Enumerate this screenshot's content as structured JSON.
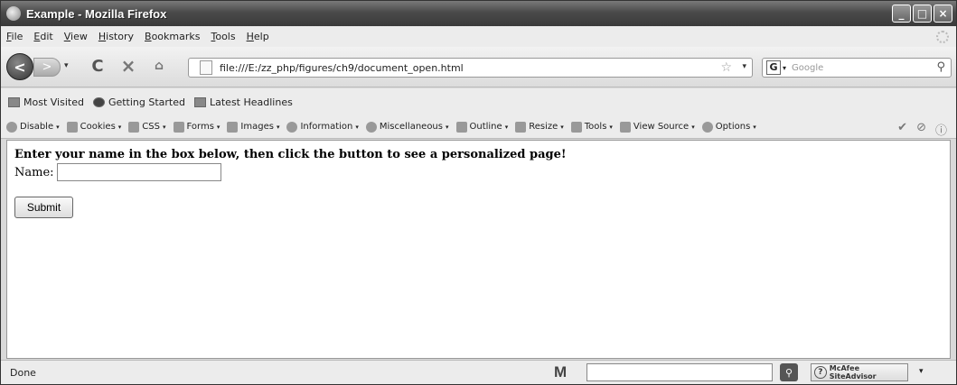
{
  "window": {
    "title": "Example - Mozilla Firefox"
  },
  "menu": [
    "File",
    "Edit",
    "View",
    "History",
    "Bookmarks",
    "Tools",
    "Help"
  ],
  "nav": {
    "url": "file:///E:/zz_php/figures/ch9/document_open.html",
    "search_placeholder": "Google"
  },
  "bookmarks": [
    "Most Visited",
    "Getting Started",
    "Latest Headlines"
  ],
  "devtoolbar": [
    "Disable",
    "Cookies",
    "CSS",
    "Forms",
    "Images",
    "Information",
    "Miscellaneous",
    "Outline",
    "Resize",
    "Tools",
    "View Source",
    "Options"
  ],
  "content": {
    "heading": "Enter your name in the box below, then click the button to see a personalized page!",
    "name_label": "Name:",
    "name_value": "",
    "submit_label": "Submit"
  },
  "status": {
    "text": "Done",
    "m_logo": "M",
    "siteadvisor": "McAfee SiteAdvisor"
  }
}
